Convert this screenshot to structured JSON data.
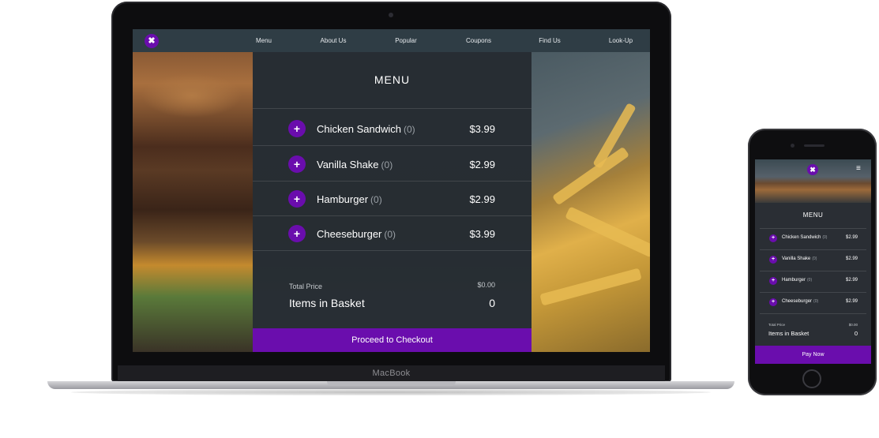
{
  "device": {
    "brand": "MacBook"
  },
  "nav": {
    "logo_icon": "close-x-icon",
    "items": [
      "Menu",
      "About Us",
      "Popular",
      "Coupons",
      "Find Us",
      "Look-Up"
    ]
  },
  "menu": {
    "title": "MENU",
    "items": [
      {
        "name": "Chicken Sandwich",
        "count": "(0)",
        "price": "$3.99"
      },
      {
        "name": "Vanilla Shake",
        "count": "(0)",
        "price": "$2.99"
      },
      {
        "name": "Hamburger",
        "count": "(0)",
        "price": "$2.99"
      },
      {
        "name": "Cheeseburger",
        "count": "(0)",
        "price": "$3.99"
      }
    ],
    "add_icon": "plus-icon",
    "total_label": "Total Price",
    "total_value": "$0.00",
    "basket_label": "Items in Basket",
    "basket_count": "0",
    "checkout_label": "Proceed to Checkout"
  },
  "phone": {
    "menu_title": "MENU",
    "hamburger_icon": "≡",
    "items": [
      {
        "name": "Chicken Sandwich",
        "count": "(0)",
        "price": "$2.99"
      },
      {
        "name": "Vanilla Shake",
        "count": "(0)",
        "price": "$2.99"
      },
      {
        "name": "Hamburger",
        "count": "(0)",
        "price": "$2.99"
      },
      {
        "name": "Cheeseburger",
        "count": "(0)",
        "price": "$2.99"
      }
    ],
    "total_label": "Total Price",
    "total_value": "$0.00",
    "basket_label": "Items in Basket",
    "basket_count": "0",
    "pay_label": "Pay Now"
  },
  "colors": {
    "accent": "#6a0dad",
    "nav_bg": "#2f3d45",
    "panel_bg": "#262c32"
  }
}
